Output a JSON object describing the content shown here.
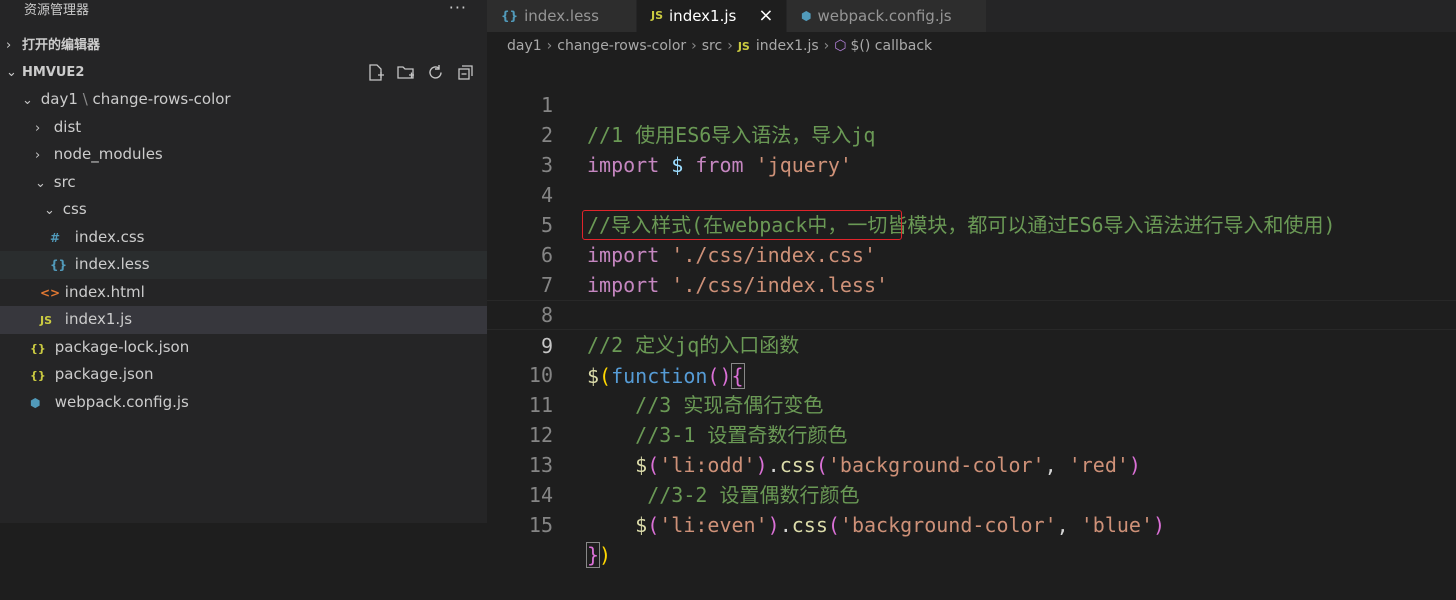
{
  "sidebar": {
    "title": "资源管理器",
    "more": "···",
    "open_editors": "打开的编辑器",
    "workspace": "HMVUE2",
    "tree": [
      {
        "label": "day1",
        "sub": "change-rows-color",
        "type": "folder-open",
        "depth": 1
      },
      {
        "label": "dist",
        "type": "folder",
        "depth": 2
      },
      {
        "label": "node_modules",
        "type": "folder",
        "depth": 2
      },
      {
        "label": "src",
        "type": "folder-open",
        "depth": 2
      },
      {
        "label": "css",
        "type": "folder-open",
        "depth": 3
      },
      {
        "label": "index.css",
        "type": "css",
        "depth": 4
      },
      {
        "label": "index.less",
        "type": "less",
        "depth": 4
      },
      {
        "label": "index.html",
        "type": "html",
        "depth": 3
      },
      {
        "label": "index1.js",
        "type": "js",
        "depth": 3
      },
      {
        "label": "package-lock.json",
        "type": "json",
        "depth": 2
      },
      {
        "label": "package.json",
        "type": "json",
        "depth": 2
      },
      {
        "label": "webpack.config.js",
        "type": "webpack",
        "depth": 2
      }
    ]
  },
  "tabs": [
    {
      "label": "index.less",
      "icon": "{}"
    },
    {
      "label": "index1.js",
      "icon": "JS"
    },
    {
      "label": "webpack.config.js",
      "icon": "webpack-icon"
    }
  ],
  "breadcrumb": {
    "p1": "day1",
    "p2": "change-rows-color",
    "p3": "src",
    "p4": "index1.js",
    "p5": "$() callback"
  },
  "code": {
    "l1": "//1 使用ES6导入语法，导入jq",
    "l2_kw1": "import",
    "l2_var": "$",
    "l2_kw2": "from",
    "l2_str": "'jquery'",
    "l4": "//导入样式(在webpack中，一切皆模块，都可以通过ES6导入语法进行导入和使用)",
    "l5_kw": "import",
    "l5_str": "'./css/index.css'",
    "l6_kw": "import",
    "l6_str": "'./css/index.less'",
    "l8": "//2 定义jq的入口函数",
    "l9_fn": "$",
    "l9_kw": "function",
    "l10": "//3 实现奇偶行变色",
    "l11": "//3-1 设置奇数行颜色",
    "l12_sel": "'li:odd'",
    "l12_css": "css",
    "l12_a1": "'background-color'",
    "l12_a2": "'red'",
    "l13": "//3-2 设置偶数行颜色",
    "l14_sel": "'li:even'",
    "l14_css": "css",
    "l14_a1": "'background-color'",
    "l14_a2": "'blue'",
    "line_numbers": [
      "1",
      "2",
      "3",
      "4",
      "5",
      "6",
      "7",
      "8",
      "9",
      "10",
      "11",
      "12",
      "13",
      "14",
      "15"
    ]
  }
}
